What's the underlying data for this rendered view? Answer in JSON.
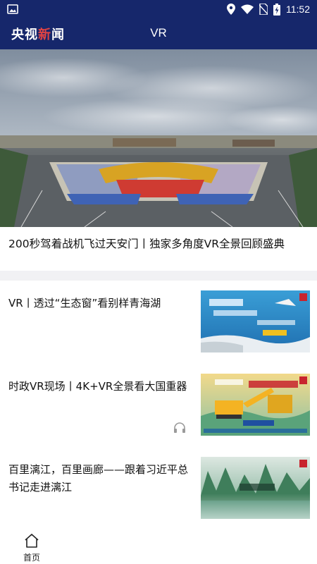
{
  "status_bar": {
    "time": "11:52",
    "icons": [
      "image-icon",
      "location-icon",
      "wifi-icon",
      "no-sim-icon",
      "battery-charging-icon"
    ]
  },
  "header": {
    "logo_part1": "央视",
    "logo_part2": "新",
    "logo_part3": "闻",
    "title": "VR"
  },
  "hero": {
    "caption": "200秒驾着战机飞过天安门丨独家多角度VR全景回顾盛典"
  },
  "news": [
    {
      "title": "VR丨透过“生态窗”看别样青海湖",
      "thumb_icon": "qinghai-lake-thumbnail"
    },
    {
      "title": "时政VR现场丨4K+VR全景看大国重器",
      "thumb_icon": "heavy-machinery-thumbnail"
    },
    {
      "title": "百里漓江，百里画廊——跟着习近平总书记走进漓江",
      "thumb_icon": "lijiang-river-thumbnail"
    }
  ],
  "bottom_nav": {
    "home_label": "首页"
  },
  "colors": {
    "header_bg": "#16276b",
    "logo_accent": "#e04343",
    "divider": "#f1f1f4"
  }
}
